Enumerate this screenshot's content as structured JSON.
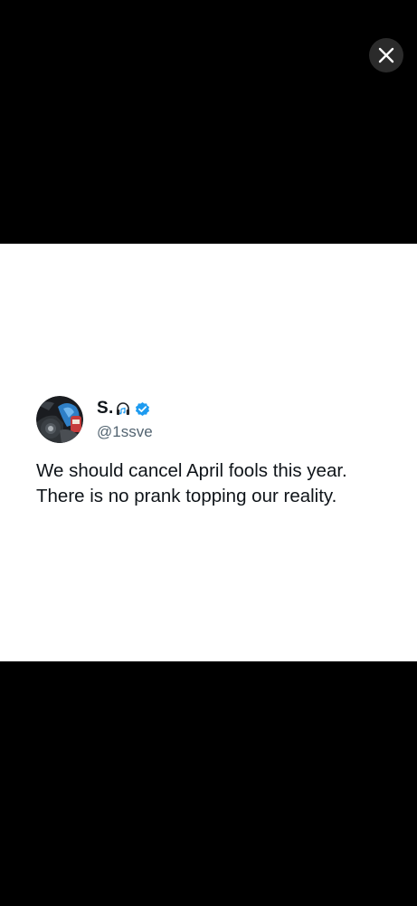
{
  "viewer": {
    "close_icon": "close-icon"
  },
  "tweet": {
    "display_name": "S.",
    "name_icons": [
      "headphone-icon",
      "verified-badge-icon"
    ],
    "handle": "@1ssve",
    "text_lines": [
      "We should cancel April fools this year.",
      "There is no prank topping our reality."
    ]
  },
  "colors": {
    "background": "#000000",
    "card": "#ffffff",
    "verified": "#1d9bf0",
    "handle": "#536471",
    "text": "#0f1419"
  }
}
